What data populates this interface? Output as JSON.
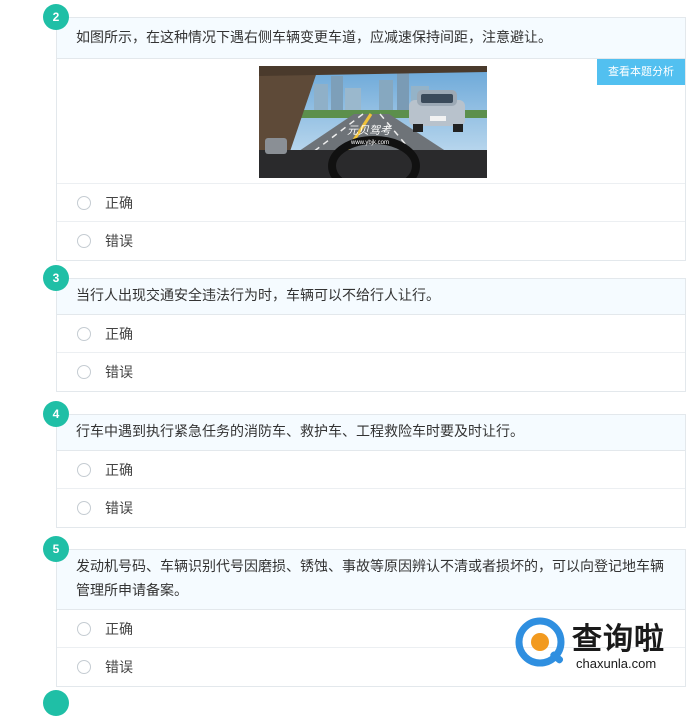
{
  "questions": [
    {
      "number": "2",
      "text": "如图所示，在这种情况下遇右侧车辆变更车道，应减速保持间距，注意避让。",
      "analysis_button": "查看本题分析",
      "image_watermark": "元贝驾考",
      "image_watermark_url": "www.ybjk.com",
      "options": [
        "正确",
        "错误"
      ]
    },
    {
      "number": "3",
      "text": "当行人出现交通安全违法行为时，车辆可以不给行人让行。",
      "options": [
        "正确",
        "错误"
      ]
    },
    {
      "number": "4",
      "text": "行车中遇到执行紧急任务的消防车、救护车、工程救险车时要及时让行。",
      "options": [
        "正确",
        "错误"
      ]
    },
    {
      "number": "5",
      "text": "发动机号码、车辆识别代号因磨损、锈蚀、事故等原因辨认不清或者损坏的，可以向登记地车辆管理所申请备案。",
      "options": [
        "正确",
        "错误"
      ]
    }
  ],
  "watermark": {
    "title": "查询啦",
    "url": "chaxunla.com"
  },
  "colors": {
    "number_badge": "#1fbfa6",
    "analysis_button": "#52c0f0",
    "header_bg": "#f5fbff",
    "logo_blue": "#2f8fe0",
    "logo_orange": "#f29a1f"
  }
}
